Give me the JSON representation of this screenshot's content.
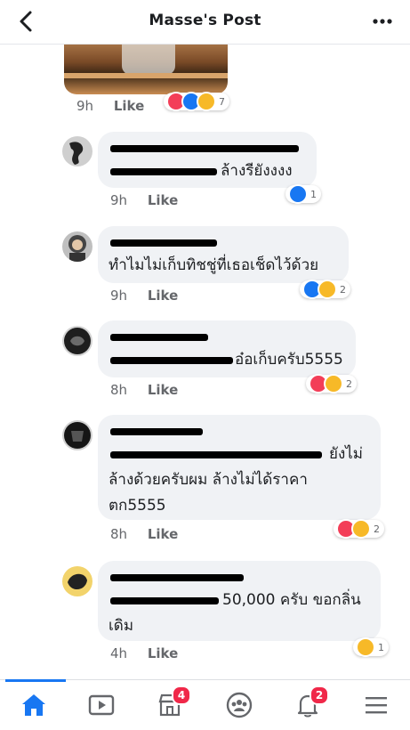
{
  "header": {
    "title": "Masse's Post",
    "back_icon": "back-arrow-icon",
    "more_icon": "more-dots-icon"
  },
  "post": {
    "time": "9h",
    "like_label": "Like",
    "reaction_count": "7"
  },
  "comments": [
    {
      "text": "ล้างรียังงงง",
      "time": "9h",
      "like_label": "Like",
      "reaction_count": "1"
    },
    {
      "text": "ทำไมไม่เก็บทิชชู่ที่เธอเช็ดไว้ด้วย",
      "time": "9h",
      "like_label": "Like",
      "reaction_count": "2"
    },
    {
      "text": "อ๋อเก็บครับ5555",
      "time": "8h",
      "like_label": "Like",
      "reaction_count": "2"
    },
    {
      "line1": "ยังไม่",
      "line2": "ล้างด้วยครับผม ล้างไม่ได้ราคา",
      "line3": "ตก5555",
      "time": "8h",
      "like_label": "Like",
      "reaction_count": "2"
    },
    {
      "line1": "50,000 ครับ ขอกลิ่น",
      "line2": "เดิม",
      "time": "4h",
      "like_label": "Like",
      "reaction_count": "1"
    }
  ],
  "tabbar": {
    "items": [
      {
        "icon": "home-icon",
        "active": true
      },
      {
        "icon": "watch-video-icon"
      },
      {
        "icon": "marketplace-icon",
        "badge": "4"
      },
      {
        "icon": "groups-icon"
      },
      {
        "icon": "notifications-bell-icon",
        "badge": "2"
      },
      {
        "icon": "menu-icon"
      }
    ]
  },
  "colors": {
    "accent": "#1877f2",
    "badge": "#f02849",
    "bubble": "#f0f2f5",
    "love": "#f33e58",
    "haha": "#f7b928"
  }
}
